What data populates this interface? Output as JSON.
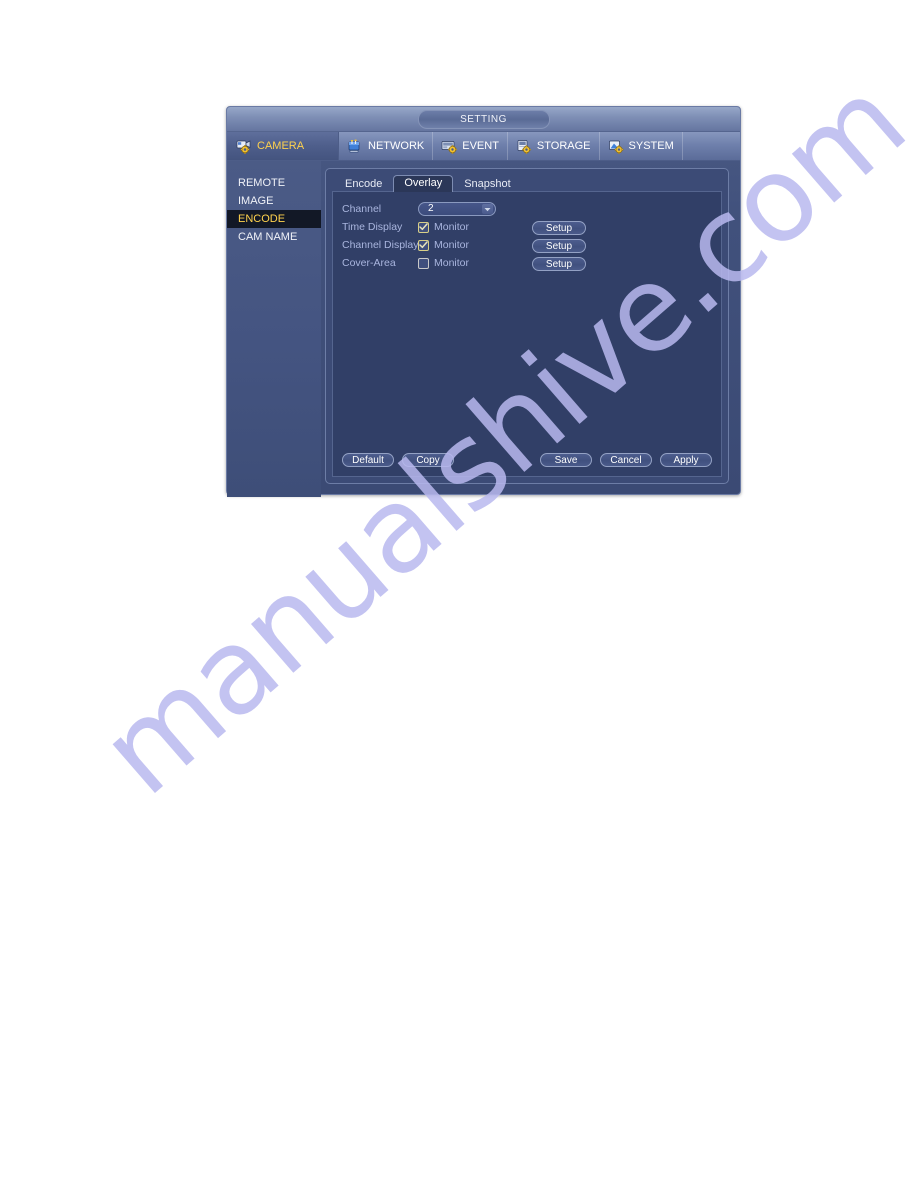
{
  "window": {
    "title": "SETTING"
  },
  "menubar": {
    "items": [
      {
        "label": "CAMERA",
        "icon": "camera-gear-icon",
        "active": true
      },
      {
        "label": "NETWORK",
        "icon": "network-icon",
        "active": false
      },
      {
        "label": "EVENT",
        "icon": "event-gear-icon",
        "active": false
      },
      {
        "label": "STORAGE",
        "icon": "storage-gear-icon",
        "active": false
      },
      {
        "label": "SYSTEM",
        "icon": "system-gear-icon",
        "active": false
      }
    ]
  },
  "sidebar": {
    "items": [
      {
        "label": "REMOTE",
        "active": false
      },
      {
        "label": "IMAGE",
        "active": false
      },
      {
        "label": "ENCODE",
        "active": true
      },
      {
        "label": "CAM NAME",
        "active": false
      }
    ]
  },
  "tabs": [
    {
      "label": "Encode",
      "active": false
    },
    {
      "label": "Overlay",
      "active": true
    },
    {
      "label": "Snapshot",
      "active": false
    }
  ],
  "form": {
    "channel": {
      "label": "Channel",
      "value": "2"
    },
    "rows": [
      {
        "label": "Time Display",
        "checkbox_label": "Monitor",
        "checked": true,
        "setup_label": "Setup"
      },
      {
        "label": "Channel Display",
        "checkbox_label": "Monitor",
        "checked": true,
        "setup_label": "Setup"
      },
      {
        "label": "Cover-Area",
        "checkbox_label": "Monitor",
        "checked": false,
        "setup_label": "Setup"
      }
    ]
  },
  "footer": {
    "left": [
      {
        "label": "Default"
      },
      {
        "label": "Copy"
      }
    ],
    "right": [
      {
        "label": "Save"
      },
      {
        "label": "Cancel"
      },
      {
        "label": "Apply"
      }
    ]
  },
  "watermark": {
    "text": "manualshive.com",
    "color": "#b9b9ef"
  },
  "colors": {
    "accent_yellow": "#ffd24d",
    "label_blue": "#a9b5de",
    "panel_bg": "#313f67",
    "window_bg": "#41517c"
  }
}
